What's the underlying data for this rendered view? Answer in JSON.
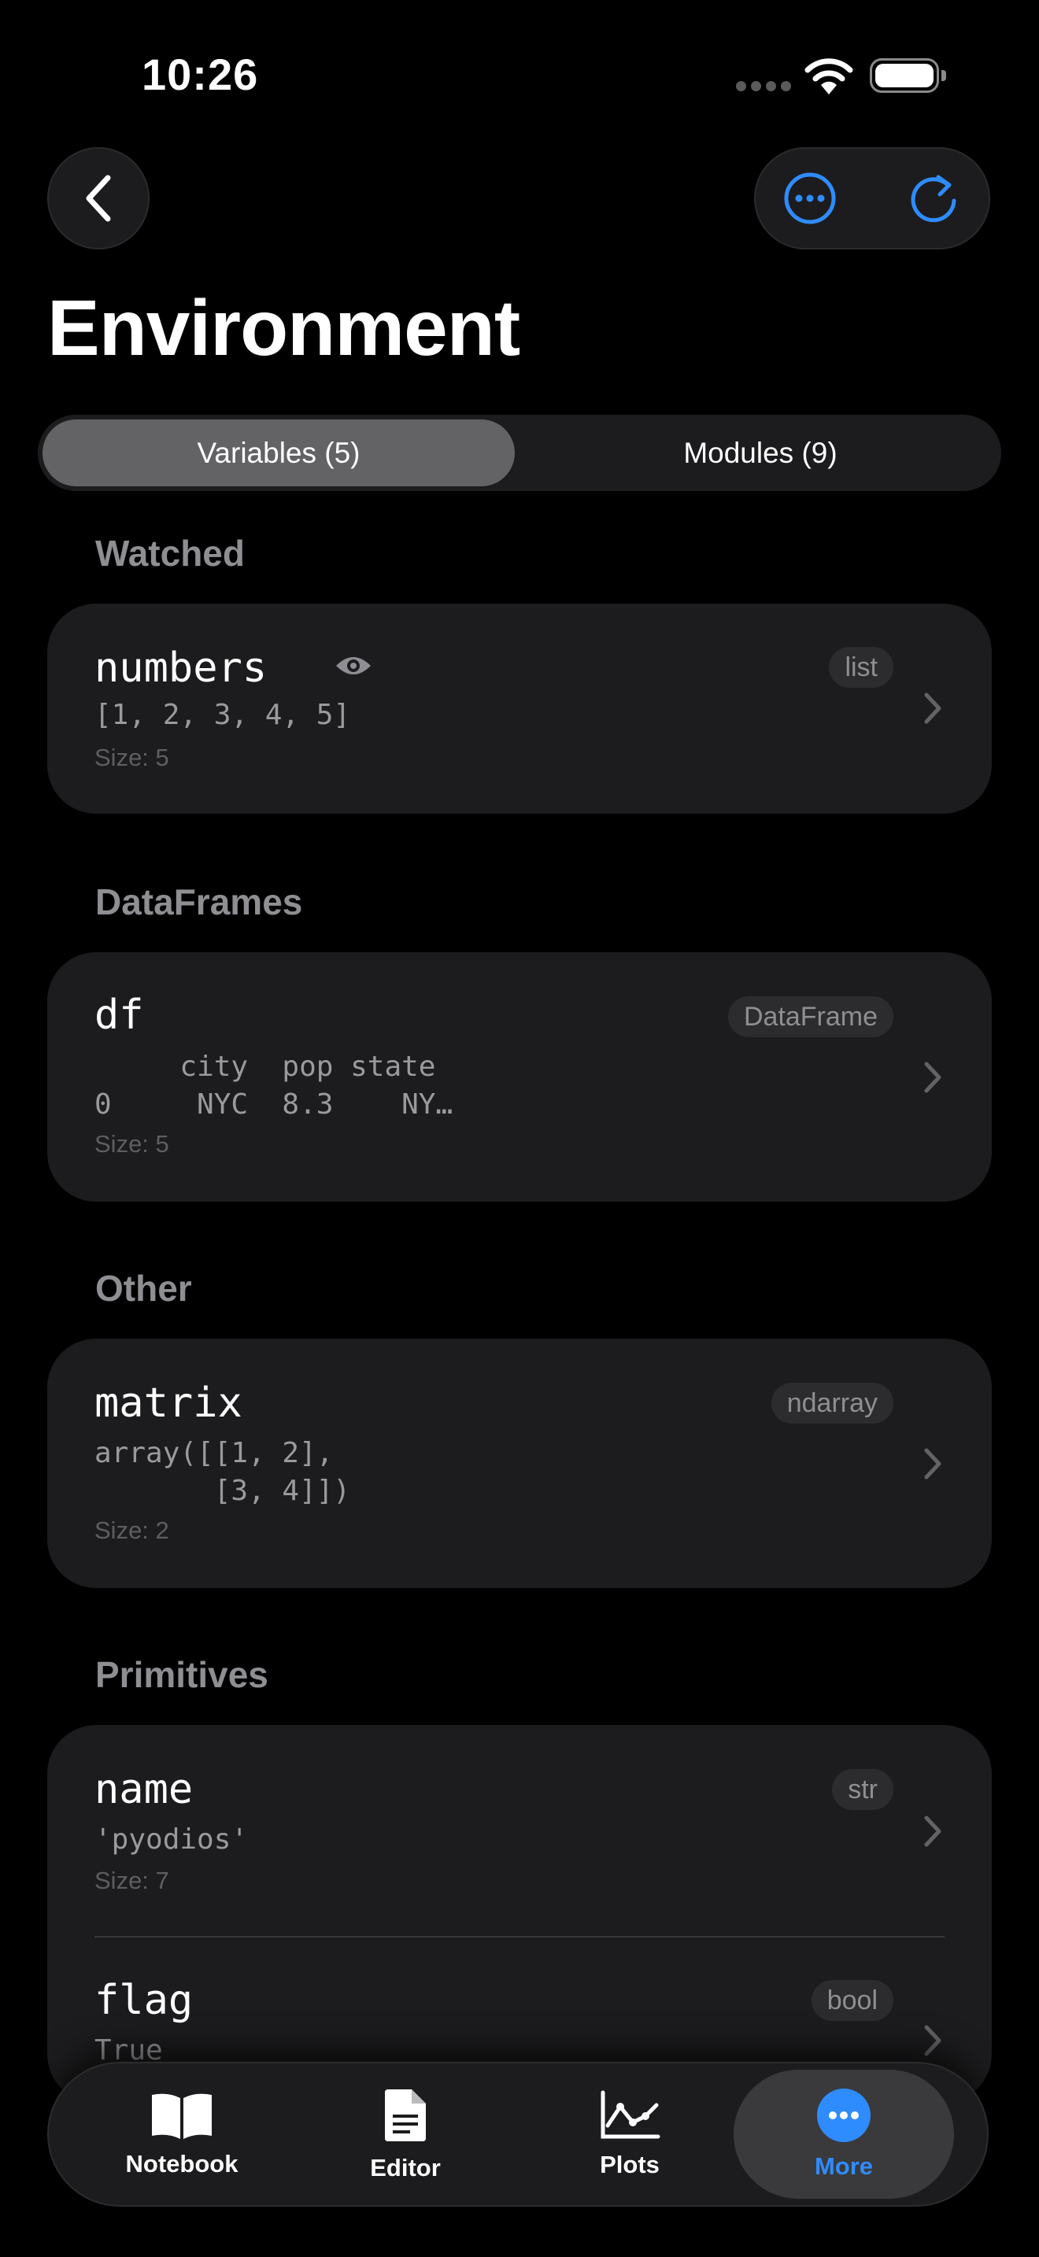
{
  "status_bar": {
    "time": "10:26"
  },
  "header": {
    "title": "Environment"
  },
  "segmented": {
    "variables_label": "Variables (5)",
    "modules_label": "Modules (9)"
  },
  "sections": {
    "watched": "Watched",
    "dataframes": "DataFrames",
    "other": "Other",
    "primitives": "Primitives"
  },
  "variables": {
    "numbers": {
      "name": "numbers",
      "value": "[1, 2, 3, 4, 5]",
      "size": "Size: 5",
      "type": "list"
    },
    "df": {
      "name": "df",
      "value": "     city  pop state\n0     NYC  8.3    NY…",
      "size": "Size: 5",
      "type": "DataFrame"
    },
    "matrix": {
      "name": "matrix",
      "value": "array([[1, 2],\n       [3, 4]])",
      "size": "Size: 2",
      "type": "ndarray"
    },
    "name": {
      "name": "name",
      "value": "'pyodios'",
      "size": "Size: 7",
      "type": "str"
    },
    "flag": {
      "name": "flag",
      "value": "True",
      "type": "bool"
    }
  },
  "tabs": {
    "notebook": "Notebook",
    "editor": "Editor",
    "plots": "Plots",
    "more": "More"
  },
  "colors": {
    "accent": "#2f8cff",
    "background": "#000000",
    "card": "#1c1c1e"
  },
  "icons": [
    "back-chevron-icon",
    "more-ellipsis-icon",
    "refresh-icon",
    "eye-icon",
    "chevron-right-icon",
    "book-icon",
    "document-icon",
    "chart-line-icon",
    "ellipsis-circle-icon"
  ]
}
